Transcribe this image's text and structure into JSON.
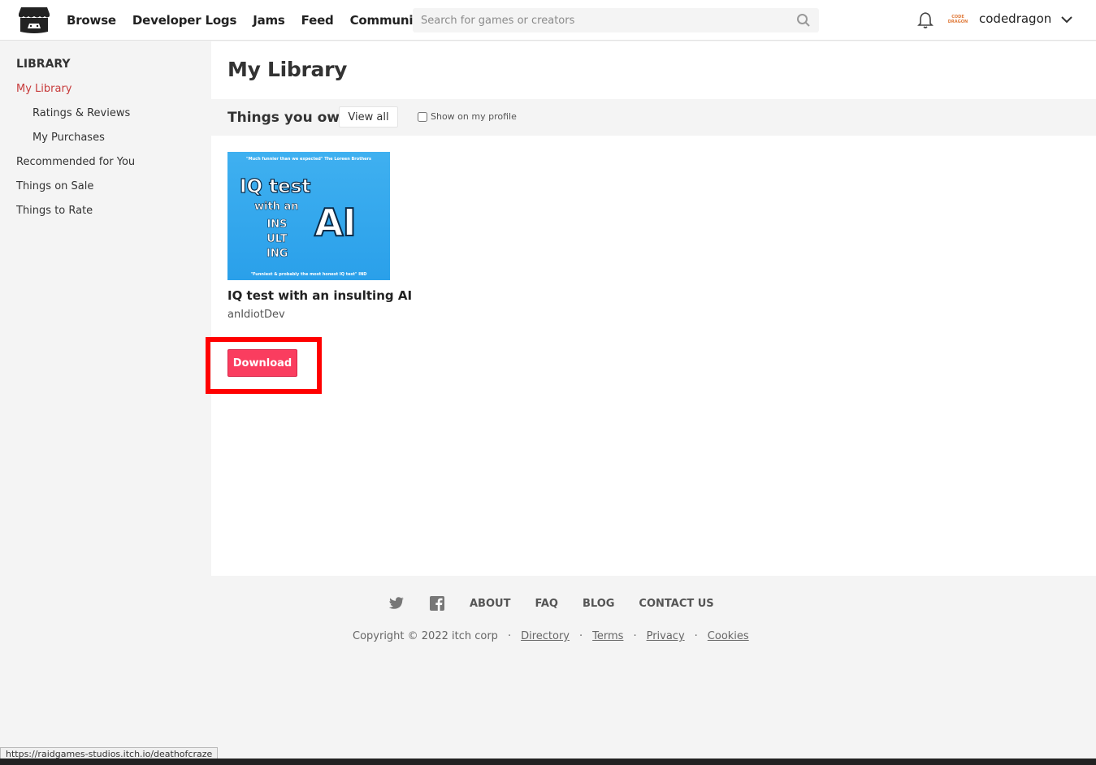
{
  "header": {
    "nav": [
      "Browse",
      "Developer Logs",
      "Jams",
      "Feed",
      "Community"
    ],
    "search_placeholder": "Search for games or creators",
    "avatar_text": "CODE DRAGON",
    "username": "codedragon"
  },
  "sidebar": {
    "heading": "LIBRARY",
    "items": [
      {
        "label": "My Library",
        "active": true
      },
      {
        "label": "Ratings & Reviews"
      },
      {
        "label": "My Purchases"
      },
      {
        "label": "Recommended for You"
      },
      {
        "label": "Things on Sale"
      },
      {
        "label": "Things to Rate"
      }
    ]
  },
  "main": {
    "title": "My Library",
    "section_title": "Things you own",
    "view_all": "View all",
    "show_on_profile": "Show on my profile",
    "game": {
      "cover_top_quote": "\"Much funnier than we expected\" The Loreen Brothers",
      "cover_line1": "IQ test",
      "cover_line2": "with an",
      "cover_ins1": "INS",
      "cover_ins2": "ULT",
      "cover_ins3": "ING",
      "cover_ai": "AI",
      "cover_bottom_quote": "\"Funniest & probably the most honest IQ test\" IND",
      "title": "IQ test with an insulting AI",
      "author": "anIdiotDev",
      "download_label": "Download"
    }
  },
  "footer": {
    "links": [
      "ABOUT",
      "FAQ",
      "BLOG",
      "CONTACT US"
    ],
    "copyright": "Copyright © 2022 itch corp",
    "legal": [
      "Directory",
      "Terms",
      "Privacy",
      "Cookies"
    ]
  },
  "status_url": "https://raidgames-studios.itch.io/deathofcraze",
  "colors": {
    "accent": "#fa3d5f",
    "active_link": "#c73b3b",
    "highlight": "#ff0000"
  }
}
